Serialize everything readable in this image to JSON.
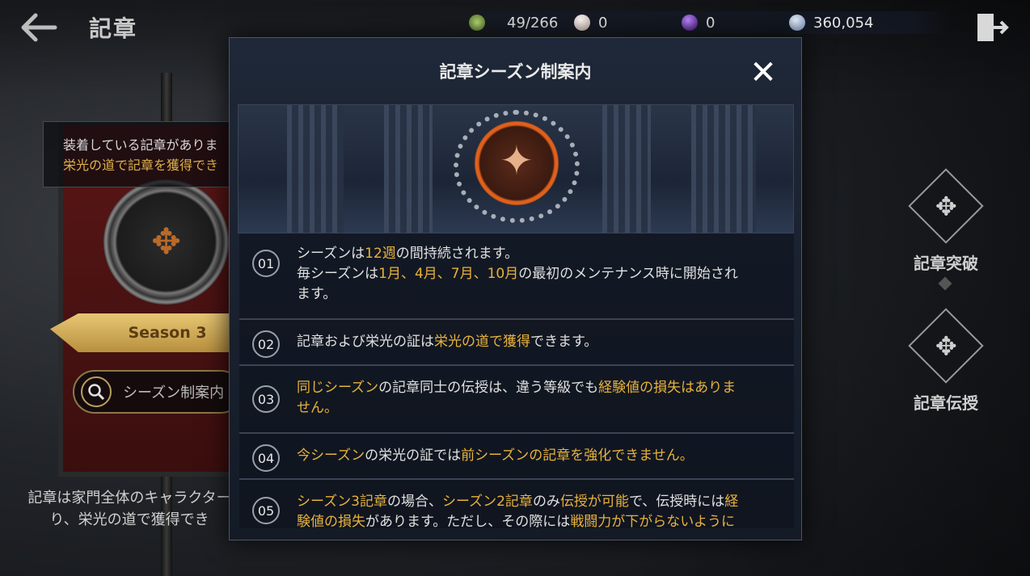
{
  "header": {
    "title": "記章",
    "resources": [
      {
        "icon": "green-gem-icon",
        "value": "49/266",
        "color": "#8fbf4a"
      },
      {
        "icon": "white-pearl-icon",
        "value": "0",
        "color": "#e8d6d0"
      },
      {
        "icon": "purple-orb-icon",
        "value": "0",
        "color": "#7a3fc4"
      },
      {
        "icon": "silver-coin-icon",
        "value": "360,054",
        "color": "#8fa6c8"
      }
    ]
  },
  "left_panel": {
    "info_line1": "装着している記章がありま",
    "info_line2": "栄光の道で記章を獲得でき",
    "season_label": "Season 3",
    "season_guide_button": "シーズン制案内",
    "bottom_note_line1": "記章は家門全体のキャラクター",
    "bottom_note_line2": "り、栄光の道で獲得でき"
  },
  "right_panel": {
    "breakthrough_label": "記章突破",
    "transfer_label": "記章伝授"
  },
  "modal": {
    "title": "記章シーズン制案内",
    "items": [
      {
        "num": "01",
        "lines": [
          [
            [
              "シーズンは",
              0
            ],
            [
              "12週",
              1
            ],
            [
              "の間持続されます。",
              0
            ]
          ],
          [
            [
              "毎シーズンは",
              0
            ],
            [
              "1月、4月、7月、10月",
              1
            ],
            [
              "の最初のメンテナンス時に開始され",
              0
            ]
          ],
          [
            [
              "ます。",
              0
            ]
          ]
        ]
      },
      {
        "num": "02",
        "lines": [
          [
            [
              "記章および栄光の証は",
              0
            ],
            [
              "栄光の道で獲得",
              1
            ],
            [
              "できます。",
              0
            ]
          ]
        ]
      },
      {
        "num": "03",
        "lines": [
          [
            [
              "同じシーズン",
              1
            ],
            [
              "の記章同士の伝授は、違う等級でも",
              0
            ],
            [
              "経験値の損失はありま",
              1
            ]
          ],
          [
            [
              "せん。",
              1
            ]
          ]
        ]
      },
      {
        "num": "04",
        "lines": [
          [
            [
              "今シーズン",
              1
            ],
            [
              "の栄光の証では",
              0
            ],
            [
              "前シーズンの記章を強化できません。",
              1
            ]
          ]
        ]
      },
      {
        "num": "05",
        "lines": [
          [
            [
              "シーズン3記章",
              1
            ],
            [
              "の場合、",
              0
            ],
            [
              "シーズン2記章",
              1
            ],
            [
              "のみ",
              0
            ],
            [
              "伝授が可能",
              1
            ],
            [
              "で、伝授時には",
              0
            ],
            [
              "経",
              1
            ]
          ],
          [
            [
              "験値の損失",
              1
            ],
            [
              "があります。ただし、その際には",
              0
            ],
            [
              "戦闘力が下がらないように",
              1
            ]
          ]
        ]
      }
    ]
  }
}
